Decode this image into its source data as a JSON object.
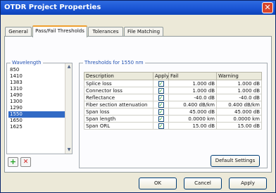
{
  "window": {
    "title": "OTDR Project Properties",
    "close_glyph": "✕"
  },
  "tabs": [
    {
      "label": "General"
    },
    {
      "label": "Pass/Fail Thresholds"
    },
    {
      "label": "Tolerances"
    },
    {
      "label": "File Matching"
    }
  ],
  "wavelength": {
    "header": "Wavelength",
    "items": [
      "850",
      "1410",
      "1383",
      "1310",
      "1490",
      "1300",
      "1290",
      "1550",
      "1650",
      "1625"
    ],
    "selected": "1550"
  },
  "thresholds": {
    "header": "Thresholds for 1550 nm",
    "columns": [
      "Description",
      "Apply",
      "Fail",
      "Warning"
    ],
    "rows": [
      {
        "description": "Splice loss",
        "apply": true,
        "fail": "1.000 dB",
        "warning": "1.000 dB"
      },
      {
        "description": "Connector loss",
        "apply": true,
        "fail": "1.000 dB",
        "warning": "1.000 dB"
      },
      {
        "description": "Reflectance",
        "apply": true,
        "fail": "-40.0 dB",
        "warning": "-40.0 dB"
      },
      {
        "description": "Fiber section attenuation",
        "apply": true,
        "fail": "0.400 dB/km",
        "warning": "0.400 dB/km"
      },
      {
        "description": "Span loss",
        "apply": true,
        "fail": "45.000 dB",
        "warning": "45.000 dB"
      },
      {
        "description": "Span length",
        "apply": true,
        "fail": "0.0000 km",
        "warning": "0.0000 km"
      },
      {
        "description": "Span ORL",
        "apply": true,
        "fail": "15.00 dB",
        "warning": "15.00 dB"
      }
    ]
  },
  "buttons": {
    "add_glyph": "+",
    "remove_glyph": "✕",
    "default_settings": "Default Settings",
    "ok": "OK",
    "cancel": "Cancel",
    "apply": "Apply"
  },
  "colors": {
    "accent_green": "#21a121",
    "remove_red": "#d02020",
    "selection_blue": "#316ac5"
  }
}
